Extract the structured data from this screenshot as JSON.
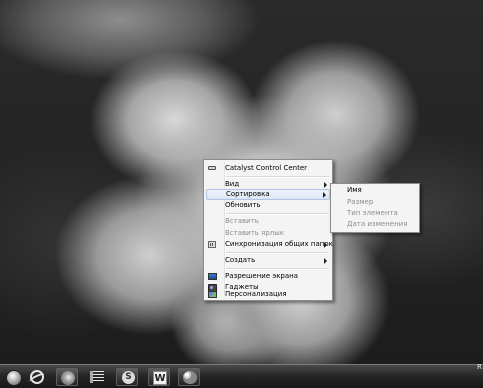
{
  "context_menu": {
    "items": [
      {
        "label": "Catalyst Control Center",
        "icon": "catalyst-icon"
      },
      {
        "label": "Вид",
        "has_submenu": true
      },
      {
        "label": "Сортировка",
        "has_submenu": true,
        "highlighted": true
      },
      {
        "label": "Обновить"
      },
      {
        "label": "Вставить",
        "disabled": true
      },
      {
        "label": "Вставить ярлык",
        "disabled": true
      },
      {
        "label": "Синхронизация общих папок",
        "has_submenu": true,
        "icon": "sync-icon"
      },
      {
        "label": "Создать",
        "has_submenu": true
      },
      {
        "label": "Разрешение экрана",
        "icon": "display-icon"
      },
      {
        "label": "Гаджеты",
        "icon": "gadgets-icon"
      },
      {
        "label": "Персонализация",
        "icon": "personalization-icon"
      }
    ]
  },
  "sort_submenu": {
    "items": [
      {
        "label": "Имя"
      },
      {
        "label": "Размер"
      },
      {
        "label": "Тип элемента"
      },
      {
        "label": "Дата изменения"
      }
    ]
  },
  "taskbar": {
    "pinned": [
      {
        "name": "internet-explorer-icon"
      },
      {
        "name": "firefox-icon"
      },
      {
        "name": "task-list-icon"
      },
      {
        "name": "skype-icon",
        "glyph": "S"
      },
      {
        "name": "word-icon",
        "glyph": "W"
      },
      {
        "name": "paint-icon"
      }
    ],
    "tray_text": "R"
  },
  "colors": {
    "menu_bg": "#f4f4f4",
    "highlight": "#dde8f6",
    "disabled_text": "#8d8d8d"
  }
}
